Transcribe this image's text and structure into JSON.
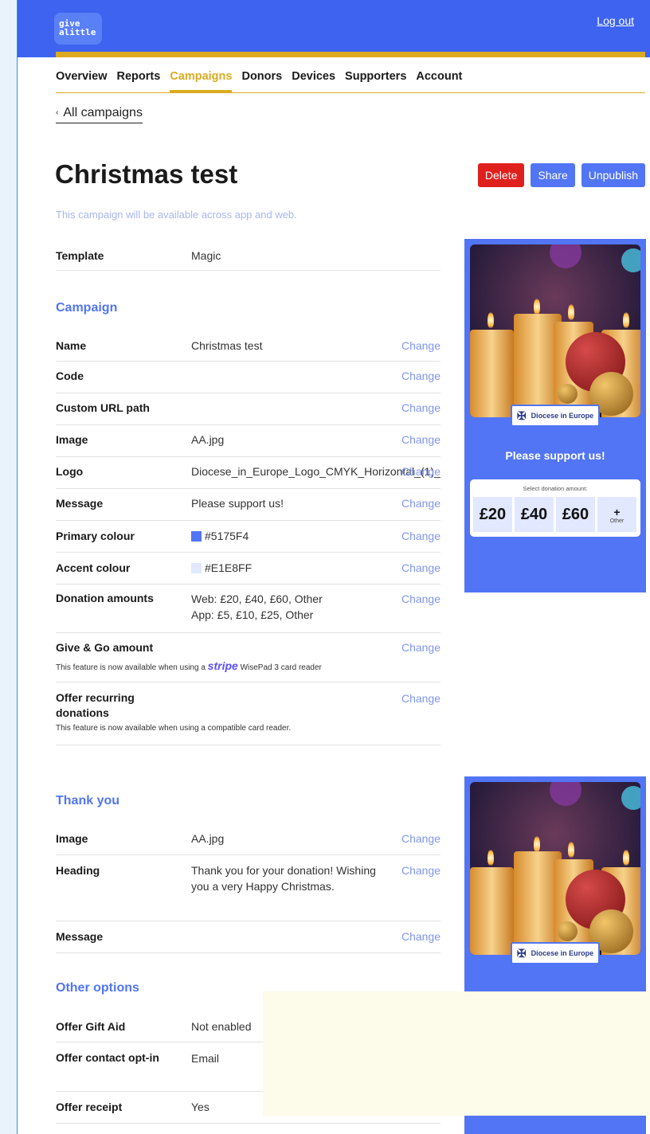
{
  "header": {
    "logo_text": "give a little",
    "logout_label": "Log out"
  },
  "nav": {
    "items": [
      "Overview",
      "Reports",
      "Campaigns",
      "Donors",
      "Devices",
      "Supporters",
      "Account"
    ],
    "active": "Campaigns"
  },
  "back_link": {
    "chevron": "‹",
    "label": "All campaigns"
  },
  "page": {
    "title": "Christmas test",
    "subtitle": "This campaign will be available across app and web.",
    "buttons": {
      "delete": "Delete",
      "share": "Share",
      "unpublish": "Unpublish"
    }
  },
  "template_row": {
    "label": "Template",
    "value": "Magic"
  },
  "change_label": "Change",
  "campaign": {
    "title": "Campaign",
    "name": {
      "label": "Name",
      "value": "Christmas test"
    },
    "code": {
      "label": "Code",
      "value": ""
    },
    "custom_url": {
      "label": "Custom URL path",
      "value": ""
    },
    "image": {
      "label": "Image",
      "value": "AA.jpg"
    },
    "logo": {
      "label": "Logo",
      "value": "Diocese_in_Europe_Logo_CMYK_Horizontal_(1)_("
    },
    "message": {
      "label": "Message",
      "value": "Please support us!"
    },
    "primary_colour": {
      "label": "Primary colour",
      "value": "#5175F4",
      "color": "#5175f4"
    },
    "accent_colour": {
      "label": "Accent colour",
      "value": "#E1E8FF",
      "color": "#e1e8ff"
    },
    "donation_amounts": {
      "label": "Donation amounts",
      "web": "Web: £20, £40, £60, Other",
      "app": "App: £5, £10, £25, Other"
    },
    "give_go": {
      "label": "Give & Go amount",
      "note_pre": "This feature is now available when using a",
      "note_brand": "stripe",
      "note_post": "WisePad 3 card reader"
    },
    "recurring": {
      "label": "Offer recurring donations",
      "note": "This feature is now available when using a compatible card reader."
    }
  },
  "thank_you": {
    "title": "Thank you",
    "image": {
      "label": "Image",
      "value": "AA.jpg"
    },
    "heading": {
      "label": "Heading",
      "value": "Thank you for your donation! Wishing you a very Happy Christmas."
    },
    "message": {
      "label": "Message",
      "value": ""
    }
  },
  "other_options": {
    "title": "Other options",
    "gift_aid": {
      "label": "Offer Gift Aid",
      "value": "Not enabled"
    },
    "contact_optin": {
      "label": "Offer contact opt-in",
      "value": "Email"
    },
    "receipt": {
      "label": "Offer receipt",
      "value": "Yes"
    }
  },
  "preview": {
    "logo_name": "Diocese in Europe",
    "message": "Please support us!",
    "select_label": "Select donation amount:",
    "amounts": [
      "£20",
      "£40",
      "£60"
    ],
    "other_symbol": "+",
    "other_label": "Other"
  }
}
